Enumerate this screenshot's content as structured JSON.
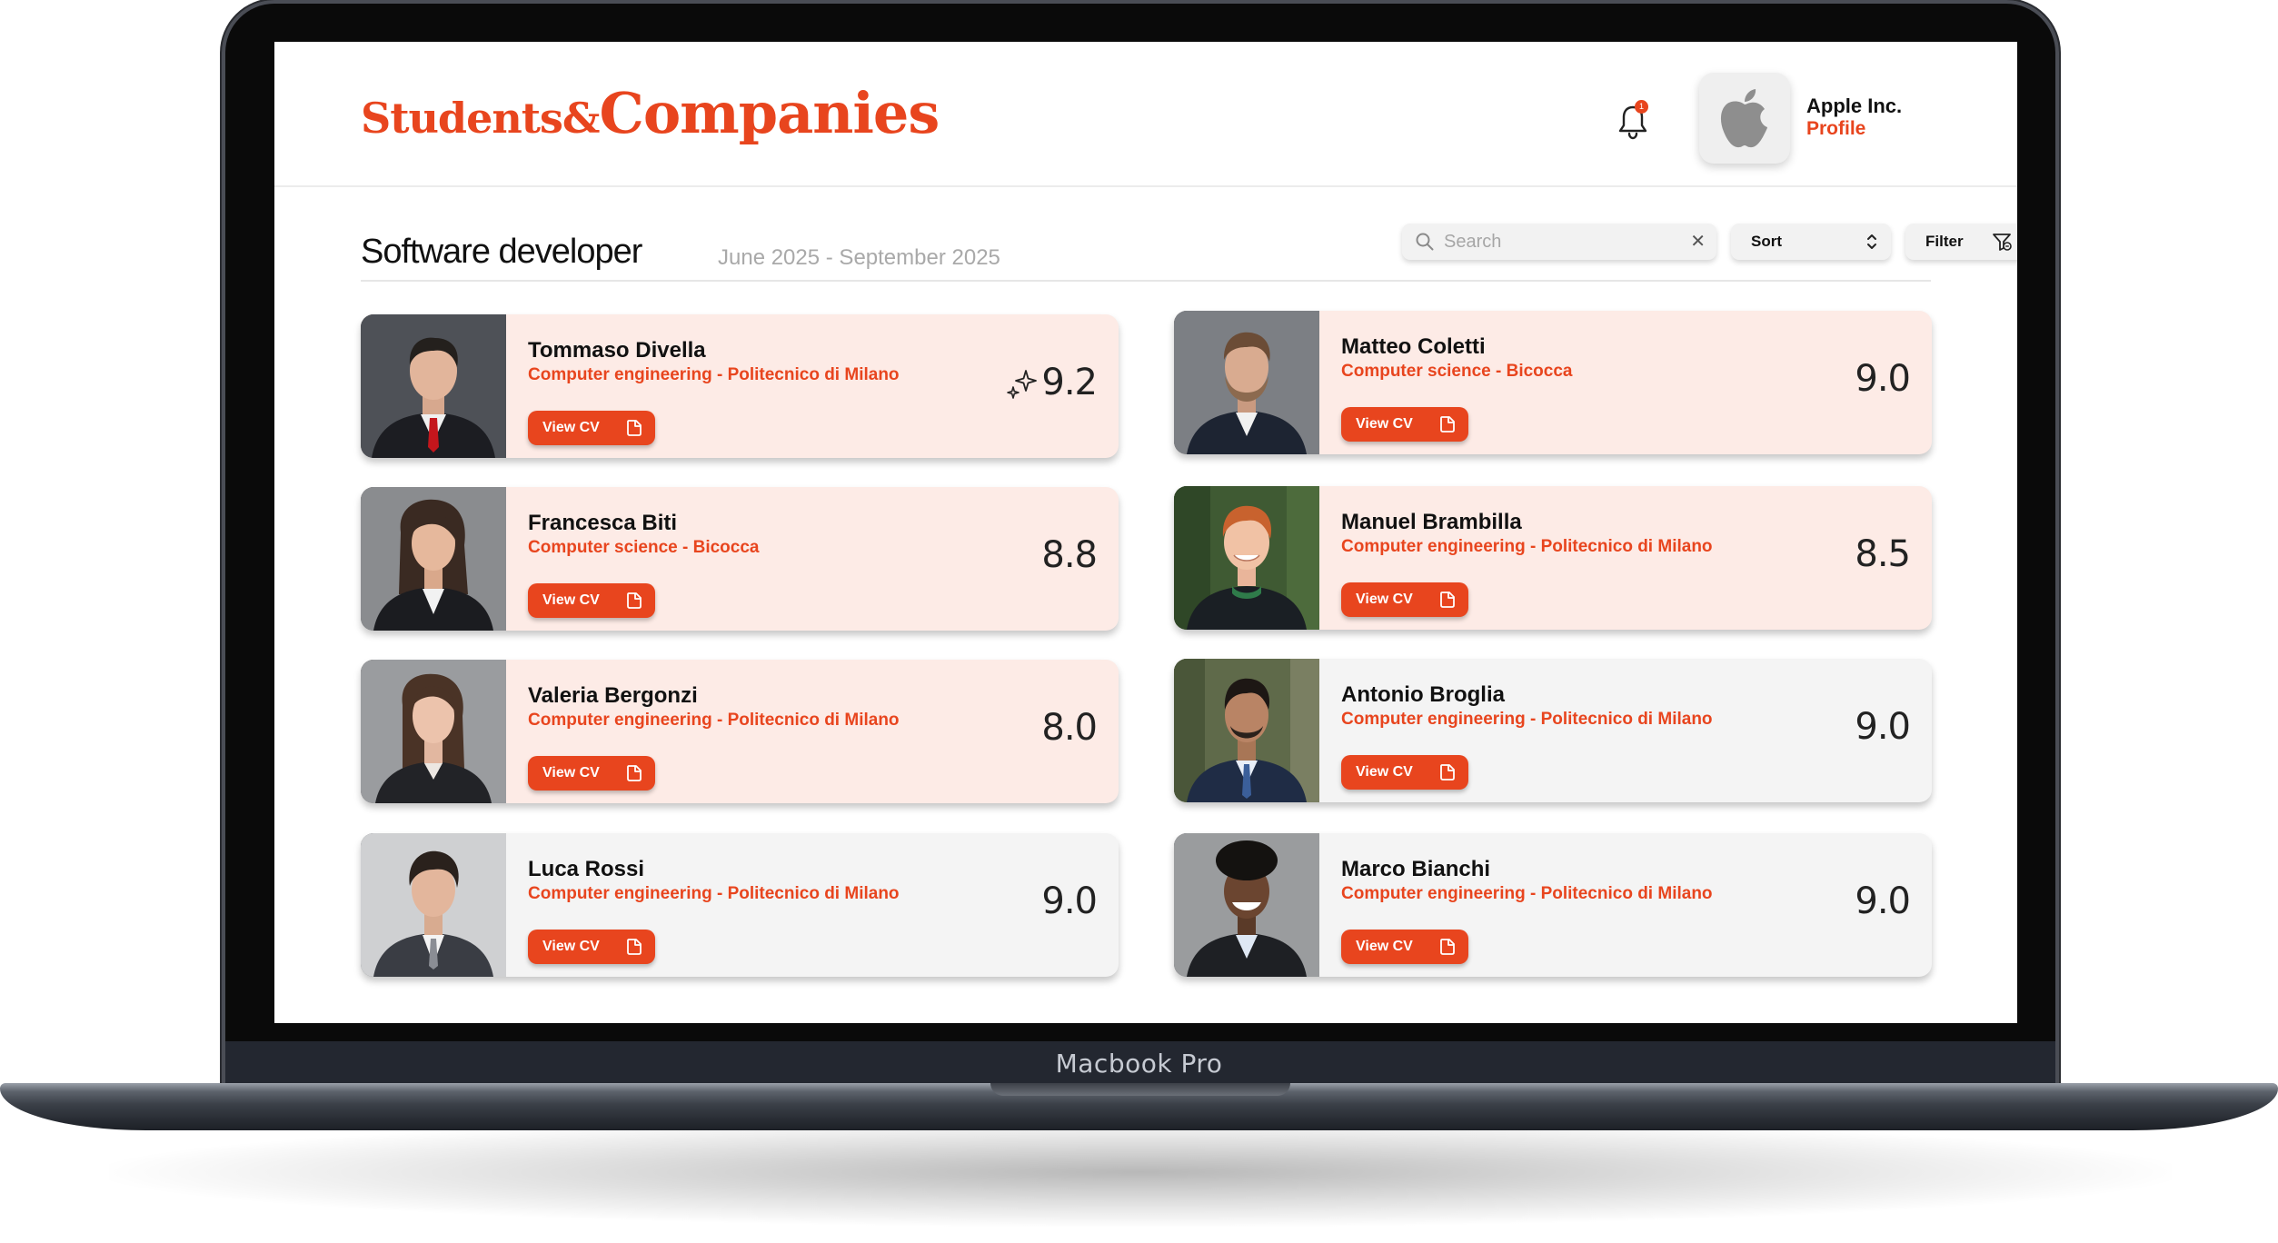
{
  "brand": {
    "part1": "Students&",
    "part2": "Companies",
    "accent": "#e8451e"
  },
  "notifications": {
    "count": "1"
  },
  "company": {
    "name": "Apple Inc.",
    "link": "Profile"
  },
  "job": {
    "title": "Software developer",
    "period": "June 2025 - September 2025"
  },
  "toolbar": {
    "search_placeholder": "Search",
    "sort_label": "Sort",
    "filter_label": "Filter"
  },
  "device_label": "Macbook Pro",
  "candidates": [
    {
      "name": "Tommaso Divella",
      "study": "Computer engineering - Politecnico di Milano",
      "score": "9.2",
      "button": "View CV",
      "highlight": true,
      "top_pick": true
    },
    {
      "name": "Matteo Coletti",
      "study": "Computer science - Bicocca",
      "score": "9.0",
      "button": "View CV",
      "highlight": true
    },
    {
      "name": "Francesca Biti",
      "study": "Computer science - Bicocca",
      "score": "8.8",
      "button": "View CV",
      "highlight": true
    },
    {
      "name": "Manuel Brambilla",
      "study": "Computer engineering - Politecnico di Milano",
      "score": "8.5",
      "button": "View CV",
      "highlight": true
    },
    {
      "name": "Valeria Bergonzi",
      "study": "Computer engineering - Politecnico di Milano",
      "score": "8.0",
      "button": "View CV",
      "highlight": true
    },
    {
      "name": "Antonio Broglia",
      "study": "Computer engineering - Politecnico di Milano",
      "score": "9.0",
      "button": "View CV",
      "highlight": false
    },
    {
      "name": "Luca Rossi",
      "study": "Computer engineering - Politecnico di Milano",
      "score": "9.0",
      "button": "View CV",
      "highlight": false
    },
    {
      "name": "Marco Bianchi",
      "study": "Computer engineering - Politecnico di Milano",
      "score": "9.0",
      "button": "View CV",
      "highlight": false
    }
  ]
}
